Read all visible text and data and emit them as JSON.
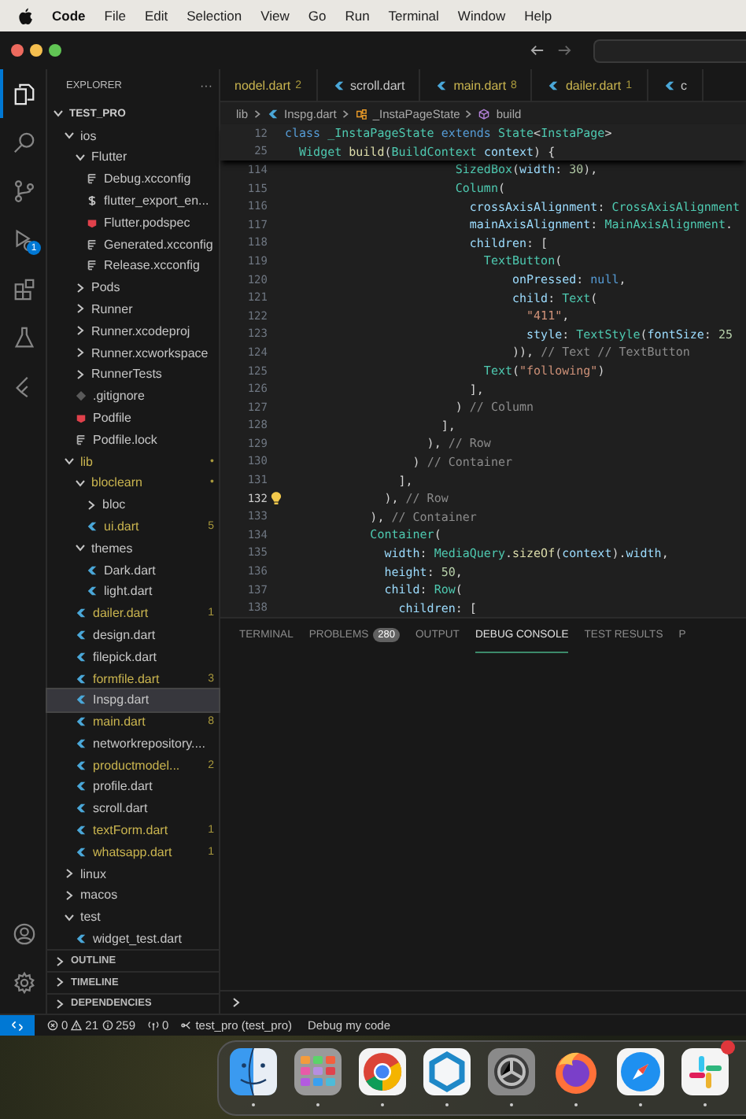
{
  "menu_bar": {
    "app": "Code",
    "items": [
      "File",
      "Edit",
      "Selection",
      "View",
      "Go",
      "Run",
      "Terminal",
      "Window",
      "Help"
    ]
  },
  "activity_bar": {
    "top": [
      {
        "kind": "explorer",
        "selected": true
      },
      {
        "kind": "search",
        "selected": false
      },
      {
        "kind": "scm",
        "selected": false
      },
      {
        "kind": "debug",
        "selected": false,
        "badge": "1"
      },
      {
        "kind": "extensions",
        "selected": false
      },
      {
        "kind": "testing",
        "selected": false
      },
      {
        "kind": "flutter",
        "selected": false
      }
    ],
    "bottom": [
      {
        "kind": "account",
        "selected": false
      },
      {
        "kind": "settings",
        "selected": false
      }
    ]
  },
  "explorer": {
    "title": "EXPLORER",
    "more": "···",
    "root": {
      "name": "TEST_PRO",
      "kind": "folder",
      "expanded": true,
      "selected": false,
      "modified": false,
      "children": [
        {
          "name": "ios",
          "kind": "folder",
          "expanded": true,
          "selected": false,
          "modified": false,
          "children": [
            {
              "name": "Flutter",
              "kind": "folder",
              "expanded": true,
              "selected": false,
              "modified": false,
              "children": [
                {
                  "name": "Debug.xcconfig",
                  "kind": "config",
                  "selected": false,
                  "modified": false
                },
                {
                  "name": "flutter_export_en...",
                  "kind": "shell",
                  "selected": false,
                  "modified": false
                },
                {
                  "name": "Flutter.podspec",
                  "kind": "ruby",
                  "selected": false,
                  "modified": false
                },
                {
                  "name": "Generated.xcconfig",
                  "kind": "config",
                  "selected": false,
                  "modified": false
                },
                {
                  "name": "Release.xcconfig",
                  "kind": "config",
                  "selected": false,
                  "modified": false
                }
              ]
            },
            {
              "name": "Pods",
              "kind": "folder",
              "expanded": false,
              "selected": false,
              "modified": false
            },
            {
              "name": "Runner",
              "kind": "folder",
              "expanded": false,
              "selected": false,
              "modified": false
            },
            {
              "name": "Runner.xcodeproj",
              "kind": "folder",
              "expanded": false,
              "selected": false,
              "modified": false
            },
            {
              "name": "Runner.xcworkspace",
              "kind": "folder",
              "expanded": false,
              "selected": false,
              "modified": false
            },
            {
              "name": "RunnerTests",
              "kind": "folder",
              "expanded": false,
              "selected": false,
              "modified": false
            },
            {
              "name": ".gitignore",
              "kind": "git",
              "selected": false,
              "modified": false
            },
            {
              "name": "Podfile",
              "kind": "ruby",
              "selected": false,
              "modified": false
            },
            {
              "name": "Podfile.lock",
              "kind": "config",
              "selected": false,
              "modified": false
            }
          ]
        },
        {
          "name": "lib",
          "kind": "folder",
          "expanded": true,
          "selected": false,
          "modified": true,
          "badge": "•",
          "children": [
            {
              "name": "bloclearn",
              "kind": "folder",
              "expanded": true,
              "selected": false,
              "modified": true,
              "badge": "•",
              "children": [
                {
                  "name": "bloc",
                  "kind": "folder",
                  "expanded": false,
                  "selected": false,
                  "modified": false
                },
                {
                  "name": "ui.dart",
                  "kind": "dart",
                  "selected": false,
                  "modified": true,
                  "badge": "5"
                }
              ]
            },
            {
              "name": "themes",
              "kind": "folder",
              "expanded": true,
              "selected": false,
              "modified": false,
              "children": [
                {
                  "name": "Dark.dart",
                  "kind": "dart",
                  "selected": false,
                  "modified": false
                },
                {
                  "name": "light.dart",
                  "kind": "dart",
                  "selected": false,
                  "modified": false
                }
              ]
            },
            {
              "name": "dailer.dart",
              "kind": "dart",
              "selected": false,
              "modified": true,
              "badge": "1"
            },
            {
              "name": "design.dart",
              "kind": "dart",
              "selected": false,
              "modified": false
            },
            {
              "name": "filepick.dart",
              "kind": "dart",
              "selected": false,
              "modified": false
            },
            {
              "name": "formfile.dart",
              "kind": "dart",
              "selected": false,
              "modified": true,
              "badge": "3"
            },
            {
              "name": "Inspg.dart",
              "kind": "dart",
              "selected": true,
              "modified": false
            },
            {
              "name": "main.dart",
              "kind": "dart",
              "selected": false,
              "modified": true,
              "badge": "8"
            },
            {
              "name": "networkrepository....",
              "kind": "dart",
              "selected": false,
              "modified": false
            },
            {
              "name": "productmodel...",
              "kind": "dart",
              "selected": false,
              "modified": true,
              "badge": "2"
            },
            {
              "name": "profile.dart",
              "kind": "dart",
              "selected": false,
              "modified": false
            },
            {
              "name": "scroll.dart",
              "kind": "dart",
              "selected": false,
              "modified": false
            },
            {
              "name": "textForm.dart",
              "kind": "dart",
              "selected": false,
              "modified": true,
              "badge": "1"
            },
            {
              "name": "whatsapp.dart",
              "kind": "dart",
              "selected": false,
              "modified": true,
              "badge": "1"
            }
          ]
        },
        {
          "name": "linux",
          "kind": "folder",
          "expanded": false,
          "selected": false,
          "modified": false
        },
        {
          "name": "macos",
          "kind": "folder",
          "expanded": false,
          "selected": false,
          "modified": false
        },
        {
          "name": "test",
          "kind": "folder",
          "expanded": true,
          "selected": false,
          "modified": false,
          "children": [
            {
              "name": "widget_test.dart",
              "kind": "dart",
              "selected": false,
              "modified": false
            }
          ]
        }
      ]
    },
    "sections": [
      {
        "title": "OUTLINE",
        "expanded": false
      },
      {
        "title": "TIMELINE",
        "expanded": false
      },
      {
        "title": "DEPENDENCIES",
        "expanded": false
      }
    ]
  },
  "tabs": [
    {
      "label": "nodel.dart",
      "badge": "2",
      "modified": true
    },
    {
      "label": "scroll.dart",
      "modified": false
    },
    {
      "label": "main.dart",
      "badge": "8",
      "modified": true
    },
    {
      "label": "dailer.dart",
      "badge": "1",
      "modified": true
    },
    {
      "label": "c",
      "modified": false
    }
  ],
  "breadcrumb": [
    {
      "label": "lib",
      "kind": "folder"
    },
    {
      "label": "Inspg.dart",
      "kind": "dart"
    },
    {
      "label": "_InstaPageState",
      "kind": "class"
    },
    {
      "label": "build",
      "kind": "method"
    }
  ],
  "sticky_lines": [
    {
      "number": "12",
      "tokens": [
        {
          "text": "class ",
          "kind": "kw"
        },
        {
          "text": "_InstaPageState ",
          "kind": "type"
        },
        {
          "text": "extends ",
          "kind": "kw"
        },
        {
          "text": "State",
          "kind": "type"
        },
        {
          "text": "<",
          "kind": "p"
        },
        {
          "text": "InstaPage",
          "kind": "type"
        },
        {
          "text": ">",
          "kind": "p"
        }
      ]
    },
    {
      "number": "25",
      "tokens": [
        {
          "text": "  Widget ",
          "kind": "type"
        },
        {
          "text": "build",
          "kind": "fn"
        },
        {
          "text": "(",
          "kind": "p"
        },
        {
          "text": "BuildContext ",
          "kind": "type"
        },
        {
          "text": "context",
          "kind": "prop"
        },
        {
          "text": ") {",
          "kind": "p"
        }
      ]
    }
  ],
  "code_lines": [
    {
      "number": "114",
      "current": false,
      "tokens": [
        {
          "text": "                        SizedBox",
          "kind": "type"
        },
        {
          "text": "(",
          "kind": "p"
        },
        {
          "text": "width",
          "kind": "prop"
        },
        {
          "text": ": ",
          "kind": "p"
        },
        {
          "text": "30",
          "kind": "num"
        },
        {
          "text": "),",
          "kind": "p"
        }
      ]
    },
    {
      "number": "115",
      "current": false,
      "tokens": [
        {
          "text": "                        Column",
          "kind": "type"
        },
        {
          "text": "(",
          "kind": "p"
        }
      ]
    },
    {
      "number": "116",
      "current": false,
      "tokens": [
        {
          "text": "                          crossAxisAlignment",
          "kind": "prop"
        },
        {
          "text": ": ",
          "kind": "p"
        },
        {
          "text": "CrossAxisAlignment",
          "kind": "type"
        }
      ]
    },
    {
      "number": "117",
      "current": false,
      "tokens": [
        {
          "text": "                          mainAxisAlignment",
          "kind": "prop"
        },
        {
          "text": ": ",
          "kind": "p"
        },
        {
          "text": "MainAxisAlignment",
          "kind": "type"
        },
        {
          "text": ".",
          "kind": "p"
        }
      ]
    },
    {
      "number": "118",
      "current": false,
      "tokens": [
        {
          "text": "                          children",
          "kind": "prop"
        },
        {
          "text": ": [",
          "kind": "p"
        }
      ]
    },
    {
      "number": "119",
      "current": false,
      "tokens": [
        {
          "text": "                            TextButton",
          "kind": "type"
        },
        {
          "text": "(",
          "kind": "p"
        }
      ]
    },
    {
      "number": "120",
      "current": false,
      "tokens": [
        {
          "text": "                                onPressed",
          "kind": "prop"
        },
        {
          "text": ": ",
          "kind": "p"
        },
        {
          "text": "null",
          "kind": "kw"
        },
        {
          "text": ",",
          "kind": "p"
        }
      ]
    },
    {
      "number": "121",
      "current": false,
      "tokens": [
        {
          "text": "                                child",
          "kind": "prop"
        },
        {
          "text": ": ",
          "kind": "p"
        },
        {
          "text": "Text",
          "kind": "type"
        },
        {
          "text": "(",
          "kind": "p"
        }
      ]
    },
    {
      "number": "122",
      "current": false,
      "tokens": [
        {
          "text": "                                  \"411\"",
          "kind": "str"
        },
        {
          "text": ",",
          "kind": "p"
        }
      ]
    },
    {
      "number": "123",
      "current": false,
      "tokens": [
        {
          "text": "                                  style",
          "kind": "prop"
        },
        {
          "text": ": ",
          "kind": "p"
        },
        {
          "text": "TextStyle",
          "kind": "type"
        },
        {
          "text": "(",
          "kind": "p"
        },
        {
          "text": "fontSize",
          "kind": "prop"
        },
        {
          "text": ": ",
          "kind": "p"
        },
        {
          "text": "25",
          "kind": "num"
        }
      ]
    },
    {
      "number": "124",
      "current": false,
      "tokens": [
        {
          "text": "                                )), ",
          "kind": "p"
        },
        {
          "text": "// Text // TextButton",
          "kind": "label"
        }
      ]
    },
    {
      "number": "125",
      "current": false,
      "tokens": [
        {
          "text": "                            Text",
          "kind": "type"
        },
        {
          "text": "(",
          "kind": "p"
        },
        {
          "text": "\"following\"",
          "kind": "str"
        },
        {
          "text": ")",
          "kind": "p"
        }
      ]
    },
    {
      "number": "126",
      "current": false,
      "tokens": [
        {
          "text": "                          ],",
          "kind": "p"
        }
      ]
    },
    {
      "number": "127",
      "current": false,
      "tokens": [
        {
          "text": "                        ) ",
          "kind": "p"
        },
        {
          "text": "// Column",
          "kind": "label"
        }
      ]
    },
    {
      "number": "128",
      "current": false,
      "tokens": [
        {
          "text": "                      ],",
          "kind": "p"
        }
      ]
    },
    {
      "number": "129",
      "current": false,
      "tokens": [
        {
          "text": "                    ), ",
          "kind": "p"
        },
        {
          "text": "// Row",
          "kind": "label"
        }
      ]
    },
    {
      "number": "130",
      "current": false,
      "tokens": [
        {
          "text": "                  ) ",
          "kind": "p"
        },
        {
          "text": "// Container",
          "kind": "label"
        }
      ]
    },
    {
      "number": "131",
      "current": false,
      "tokens": [
        {
          "text": "                ],",
          "kind": "p"
        }
      ]
    },
    {
      "number": "132",
      "current": true,
      "tokens": [
        {
          "text": "              ), ",
          "kind": "p"
        },
        {
          "text": "// Row",
          "kind": "label"
        }
      ]
    },
    {
      "number": "133",
      "current": false,
      "tokens": [
        {
          "text": "            ), ",
          "kind": "p"
        },
        {
          "text": "// Container",
          "kind": "label"
        }
      ]
    },
    {
      "number": "134",
      "current": false,
      "tokens": [
        {
          "text": "            Container",
          "kind": "type"
        },
        {
          "text": "(",
          "kind": "p"
        }
      ]
    },
    {
      "number": "135",
      "current": false,
      "tokens": [
        {
          "text": "              width",
          "kind": "prop"
        },
        {
          "text": ": ",
          "kind": "p"
        },
        {
          "text": "MediaQuery",
          "kind": "type"
        },
        {
          "text": ".",
          "kind": "p"
        },
        {
          "text": "sizeOf",
          "kind": "fn"
        },
        {
          "text": "(",
          "kind": "p"
        },
        {
          "text": "context",
          "kind": "prop"
        },
        {
          "text": ").",
          "kind": "p"
        },
        {
          "text": "width",
          "kind": "prop"
        },
        {
          "text": ",",
          "kind": "p"
        }
      ]
    },
    {
      "number": "136",
      "current": false,
      "tokens": [
        {
          "text": "              height",
          "kind": "prop"
        },
        {
          "text": ": ",
          "kind": "p"
        },
        {
          "text": "50",
          "kind": "num"
        },
        {
          "text": ",",
          "kind": "p"
        }
      ]
    },
    {
      "number": "137",
      "current": false,
      "tokens": [
        {
          "text": "              child",
          "kind": "prop"
        },
        {
          "text": ": ",
          "kind": "p"
        },
        {
          "text": "Row",
          "kind": "type"
        },
        {
          "text": "(",
          "kind": "p"
        }
      ]
    },
    {
      "number": "138",
      "current": false,
      "tokens": [
        {
          "text": "                children",
          "kind": "prop"
        },
        {
          "text": ": [",
          "kind": "p"
        }
      ]
    }
  ],
  "panel": {
    "tabs": [
      {
        "label": "TERMINAL",
        "selected": false
      },
      {
        "label": "PROBLEMS",
        "badge": "280",
        "selected": false
      },
      {
        "label": "OUTPUT",
        "selected": false
      },
      {
        "label": "DEBUG CONSOLE",
        "selected": true
      },
      {
        "label": "TEST RESULTS",
        "selected": false
      },
      {
        "label": "P",
        "selected": false
      }
    ]
  },
  "status_bar": {
    "errors": "0",
    "warnings": "21",
    "infos": "259",
    "ports": "0",
    "target": "test_pro (test_pro)",
    "message": "Debug my code"
  },
  "dock": [
    {
      "kind": "finder",
      "running": true,
      "notification": false
    },
    {
      "kind": "launchpad",
      "running": true,
      "notification": false
    },
    {
      "kind": "chrome",
      "running": true,
      "notification": false
    },
    {
      "kind": "hexagon",
      "running": true,
      "notification": false
    },
    {
      "kind": "settings",
      "running": true,
      "notification": false
    },
    {
      "kind": "firefox",
      "running": true,
      "notification": false
    },
    {
      "kind": "safari",
      "running": true,
      "notification": false
    },
    {
      "kind": "slack",
      "running": true,
      "notification": true
    }
  ]
}
